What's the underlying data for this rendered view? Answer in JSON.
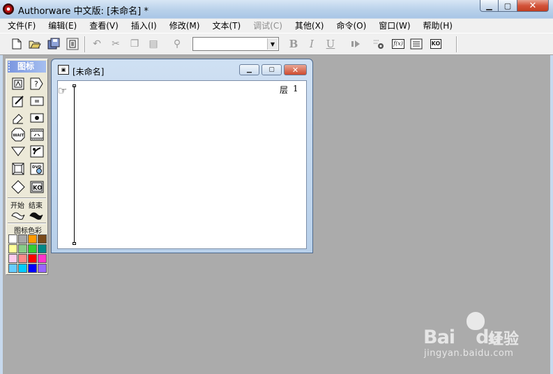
{
  "window": {
    "title": "Authorware 中文版: [未命名] *",
    "minimize_glyph": "▁",
    "maximize_glyph": "▢",
    "close_glyph": "✕"
  },
  "menu": [
    {
      "label": "文件(F)",
      "enabled": true
    },
    {
      "label": "编辑(E)",
      "enabled": true
    },
    {
      "label": "查看(V)",
      "enabled": true
    },
    {
      "label": "插入(I)",
      "enabled": true
    },
    {
      "label": "修改(M)",
      "enabled": true
    },
    {
      "label": "文本(T)",
      "enabled": true
    },
    {
      "label": "调试(C)",
      "enabled": false
    },
    {
      "label": "其他(X)",
      "enabled": true
    },
    {
      "label": "命令(O)",
      "enabled": true
    },
    {
      "label": "窗口(W)",
      "enabled": true
    },
    {
      "label": "帮助(H)",
      "enabled": true
    }
  ],
  "toolbar": {
    "new_icon": "new-file-icon",
    "open_icon": "open-folder-icon",
    "save_all_icon": "save-all-icon",
    "import_icon": "import-icon",
    "undo_icon": "undo-icon",
    "cut_icon": "cut-icon",
    "copy_icon": "copy-icon",
    "paste_icon": "paste-icon",
    "find_icon": "find-icon",
    "font_value": "",
    "bold_label": "B",
    "italic_label": "I",
    "underline_label": "U",
    "run_icon": "run-icon",
    "control_panel_icon": "control-panel-icon",
    "functions_label": "f(x)",
    "variables_icon": "variables-icon",
    "knowledge_objects_label": "KO"
  },
  "palette": {
    "title": "图标",
    "start_label": "开始",
    "end_label": "结束",
    "colors_label": "图标色彩",
    "icons": [
      "display-icon",
      "motion-icon",
      "erase-icon",
      "wait-icon",
      "navigate-icon",
      "framework-icon",
      "decision-icon",
      "interaction-icon",
      "calculation-icon",
      "map-icon",
      "digital-movie-icon",
      "sound-icon",
      "dvd-icon",
      "knowledge-object-icon"
    ],
    "wait_label": "WAIT",
    "dvd_label": "DVD",
    "ko_label": "KO",
    "colors": [
      "#ffffff",
      "#a8a8a8",
      "#ff9900",
      "#7a4a1a",
      "#ffff99",
      "#88cc88",
      "#33cc33",
      "#008888",
      "#ffccee",
      "#ff8888",
      "#ff0000",
      "#ff33cc",
      "#66ccff",
      "#00ccff",
      "#0000ff",
      "#9966ff"
    ]
  },
  "flow_window": {
    "title": "[未命名]",
    "layer_label": "层",
    "layer_value": "1"
  },
  "watermark": {
    "brand": "Bai",
    "brand2": "du",
    "cn": "经验",
    "url": "jingyan.baidu.com"
  }
}
